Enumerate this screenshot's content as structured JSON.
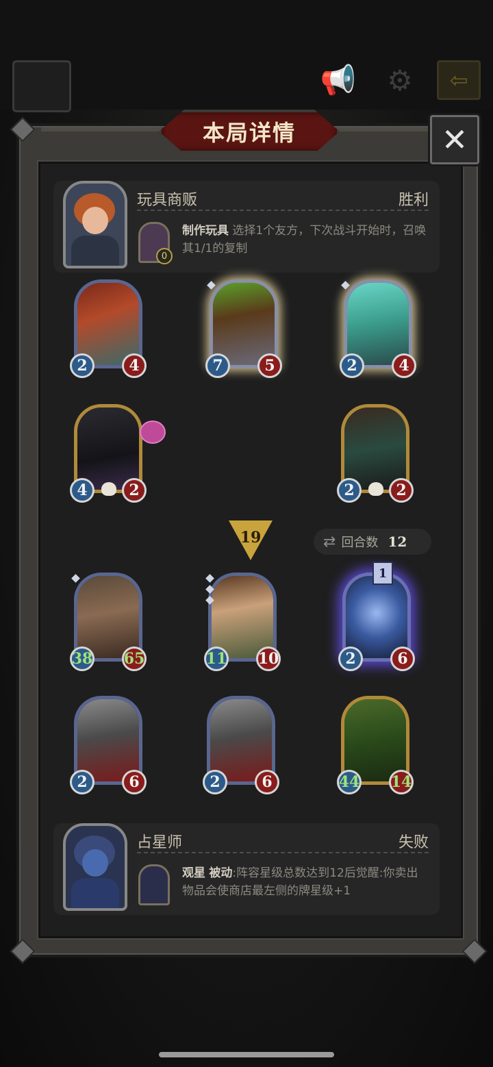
{
  "dialog": {
    "title": "本局详情",
    "close_label": "✕"
  },
  "opponent": {
    "name": "玩具商贩",
    "result": "胜利",
    "item_count": "0",
    "ability_name": "制作玩具",
    "ability_desc": "选择1个友方，下次战斗开始时，召唤其1/1的复制"
  },
  "opponent_units": [
    {
      "atk": "2",
      "hp": "4"
    },
    {
      "atk": "7",
      "hp": "5"
    },
    {
      "atk": "2",
      "hp": "4"
    },
    {
      "atk": "4",
      "hp": "2"
    },
    {
      "atk": "2",
      "hp": "2"
    }
  ],
  "tier": "19",
  "rounds": {
    "label": "回合数",
    "value": "12"
  },
  "player_units": [
    {
      "atk": "38",
      "hp": "65"
    },
    {
      "atk": "11",
      "hp": "10"
    },
    {
      "atk": "2",
      "hp": "6",
      "level": "1"
    },
    {
      "atk": "2",
      "hp": "6"
    },
    {
      "atk": "2",
      "hp": "6"
    },
    {
      "atk": "44",
      "hp": "14"
    }
  ],
  "player": {
    "name": "占星师",
    "result": "失败",
    "ability_name": "观星",
    "ability_type": "被动",
    "ability_desc": ":阵容星级总数达到12后觉醒:你卖出物品会使商店最左侧的牌星级+1"
  },
  "colors": {
    "atk": "#2c5b8a",
    "hp": "#8a1c1c",
    "banner": "#5a1512",
    "gold": "#c9a43c"
  }
}
